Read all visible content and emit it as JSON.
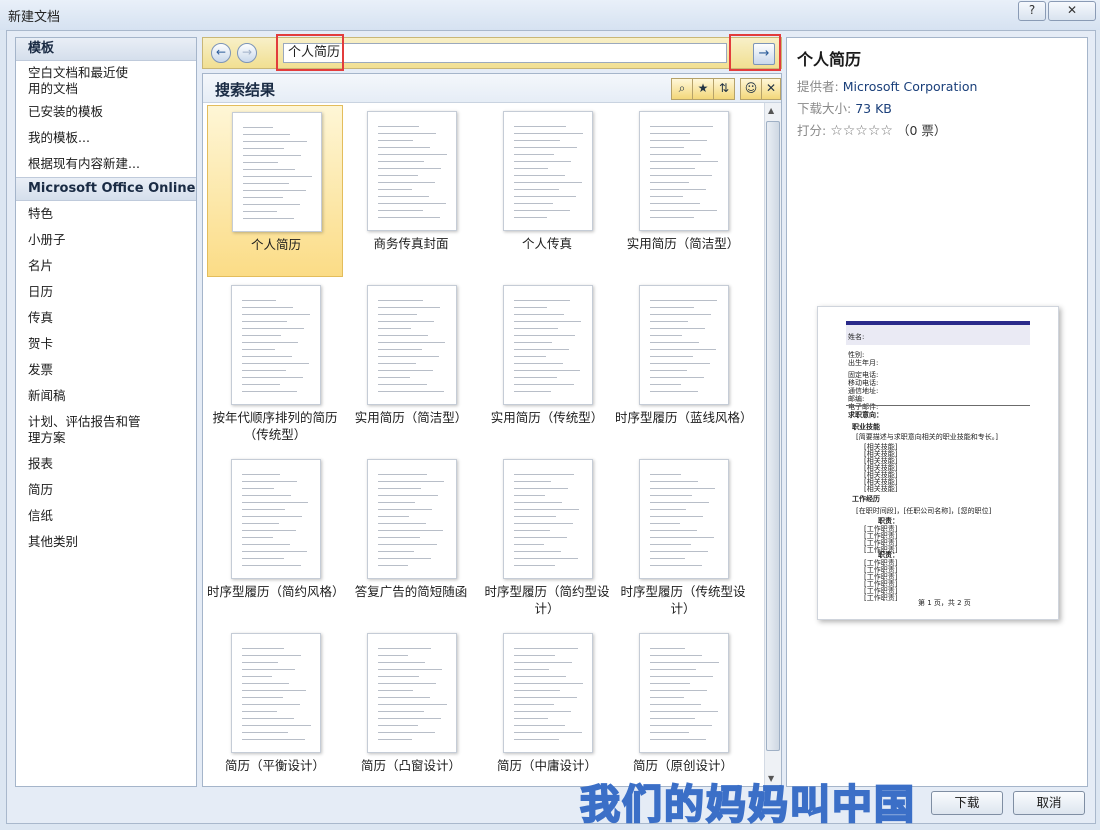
{
  "window": {
    "title": "新建文档",
    "help_label": "?",
    "close_label": "✕"
  },
  "sidebar": {
    "header": "模板",
    "items": [
      "空白文档和最近使用的文档",
      "已安装的模板",
      "我的模板...",
      "根据现有内容新建..."
    ],
    "online_header": "Microsoft Office Online",
    "online_items": [
      "特色",
      "小册子",
      "名片",
      "日历",
      "传真",
      "贺卡",
      "发票",
      "新闻稿",
      "计划、评估报告和管理方案",
      "报表",
      "简历",
      "信纸",
      "其他类别"
    ]
  },
  "search": {
    "value": "个人简历",
    "back_icon": "arrow-left-icon",
    "forward_icon": "arrow-right-icon",
    "go_icon": "arrow-right-icon"
  },
  "results": {
    "title": "搜索结果",
    "templates": [
      {
        "label": "个人简历",
        "selected": true
      },
      {
        "label": "商务传真封面"
      },
      {
        "label": "个人传真"
      },
      {
        "label": "实用简历（简洁型）"
      },
      {
        "label": "按年代顺序排列的简历（传统型）"
      },
      {
        "label": "实用简历（简洁型）"
      },
      {
        "label": "实用简历（传统型）"
      },
      {
        "label": "时序型履历（蓝线风格）"
      },
      {
        "label": "时序型履历（简约风格）"
      },
      {
        "label": "答复广告的简短随函"
      },
      {
        "label": "时序型履历（简约型设计）"
      },
      {
        "label": "时序型履历（传统型设计）"
      },
      {
        "label": "简历（平衡设计）"
      },
      {
        "label": "简历（凸窗设计）"
      },
      {
        "label": "简历（中庸设计）"
      },
      {
        "label": "简历（原创设计）"
      }
    ]
  },
  "detail": {
    "title": "个人简历",
    "provider_label": "提供者:",
    "provider": "Microsoft Corporation",
    "size_label": "下载大小:",
    "size": "73 KB",
    "rating_label": "打分:",
    "stars": "☆☆☆☆☆",
    "votes": "（0 票）",
    "preview": {
      "name_label": "姓名:",
      "fields": [
        "性别:",
        "出生年月:",
        "固定电话:",
        "移动电话:",
        "通信地址:",
        "邮编:",
        "电子邮件:"
      ],
      "objective": "求职意向：",
      "skills_title": "职业技能",
      "skills_intro": "[简要描述与求职意向相关的职业技能和专长。]",
      "skill_item": "[相关技能]",
      "work_title": "工作经历",
      "work_line": "[在职时间段]，[任职公司名称]，[您的职位]",
      "duty_label": "职责：",
      "duty_item": "[工作职责]",
      "footer": "第 1 页，共 2 页"
    }
  },
  "buttons": {
    "download": "下载",
    "cancel": "取消"
  },
  "watermark": "我们的妈妈叫中国"
}
